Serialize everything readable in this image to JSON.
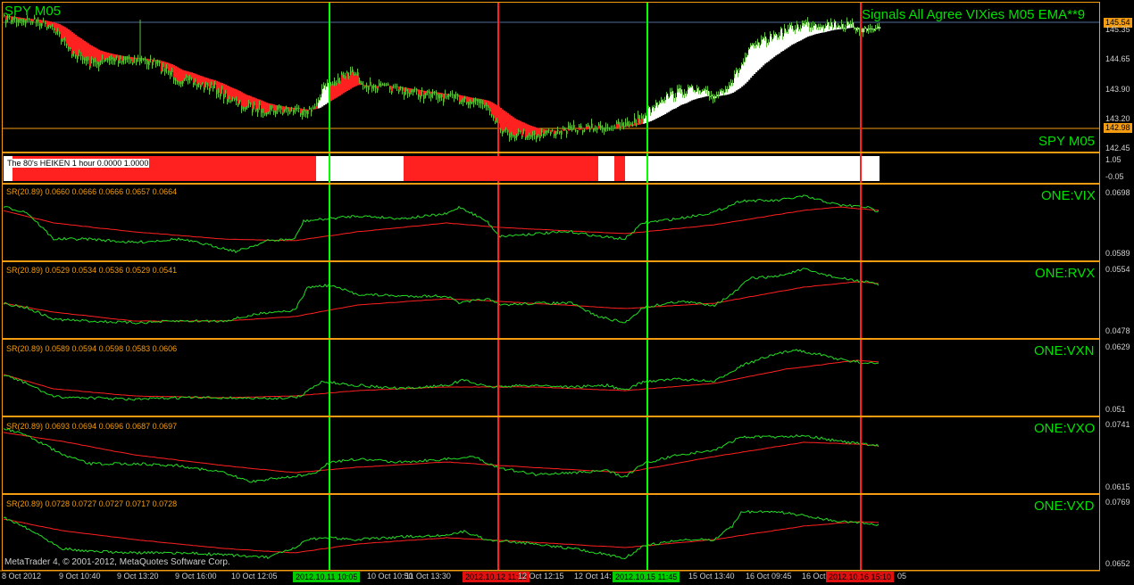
{
  "colors": {
    "background": "#000000",
    "border": "#f39c12",
    "title": "#00e000",
    "signal_green": "#00ff00",
    "signal_red": "#ff2020",
    "ema_red": "#ff2020",
    "series_green": "#22dd22",
    "scale_text": "#cfcfcf",
    "price_tag": "#f39c12"
  },
  "main": {
    "title_left": "SPY M05",
    "title_right": "Signals All Agree VIXies M05 EMA**9",
    "label_bottom": "SPY M05",
    "price_tag_top": "145.54",
    "price_tag_bottom": "142.98",
    "scale": [
      "145.35",
      "144.65",
      "143.90",
      "143.20",
      "142.45"
    ]
  },
  "heiken": {
    "label": "The 80's HEIKEN 1 hour 0.0000 1.0000",
    "scale": [
      "1.05",
      "-0.05"
    ]
  },
  "panes": [
    {
      "info": "SR(20.89) 0.0660 0.0666 0.0666 0.0657 0.0664",
      "title": "ONE:VIX",
      "scale_top": "0.0698",
      "scale_bottom": "0.0589"
    },
    {
      "info": "SR(20.89) 0.0529 0.0534 0.0536 0.0529 0.0541",
      "title": "ONE:RVX",
      "scale_top": "0.0554",
      "scale_bottom": "0.0478"
    },
    {
      "info": "SR(20.89) 0.0589 0.0594 0.0598 0.0583 0.0606",
      "title": "ONE:VXN",
      "scale_top": "0.0629",
      "scale_bottom": "0.051"
    },
    {
      "info": "SR(20.89) 0.0693 0.0694 0.0696 0.0687 0.0697",
      "title": "ONE:VXO",
      "scale_top": "0.0741",
      "scale_bottom": "0.0615"
    },
    {
      "info": "SR(20.89) 0.0728 0.0727 0.0727 0.0717 0.0728",
      "title": "ONE:VXD",
      "scale_top": "0.0769",
      "scale_bottom": "0.0652"
    }
  ],
  "copyright": "MetaTrader 4, © 2001-2012, MetaQuotes Software Corp.",
  "time_axis": [
    "8 Oct 2012",
    "9 Oct 10:40",
    "9 Oct 13:20",
    "9 Oct 16:00",
    "10 Oct 12:05",
    "10 Oct 10:50",
    "11 Oct 13:30",
    "12 Oct 12:15",
    "12 Oct 14:",
    "15 Oct 13:40",
    "16 Oct 09:45",
    "16 Oct"
  ],
  "time_highlights": [
    {
      "text": "2012.10.11 10:05",
      "color": "green"
    },
    {
      "text": "2012.10.12 11:25",
      "color": "red"
    },
    {
      "text": "2012.10.15 11:45",
      "color": "green"
    },
    {
      "text": "2012.10.16 15:10",
      "color": "red"
    }
  ],
  "time_tail": "05"
}
